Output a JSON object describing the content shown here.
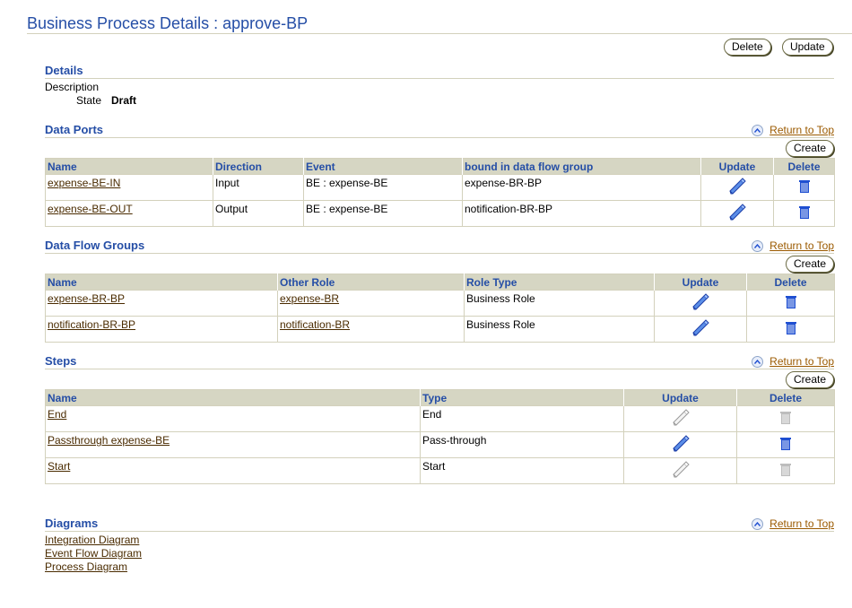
{
  "page": {
    "title": "Business Process Details : approve-BP"
  },
  "header_buttons": {
    "delete": "Delete",
    "update": "Update"
  },
  "details": {
    "heading": "Details",
    "description_label": "Description",
    "description_value": "",
    "state_label": "State",
    "state_value": "Draft"
  },
  "return_to_top": "Return to Top",
  "create_label": "Create",
  "data_ports": {
    "heading": "Data Ports",
    "columns": [
      "Name",
      "Direction",
      "Event",
      "bound in data flow group",
      "Update",
      "Delete"
    ],
    "rows": [
      {
        "name": "expense-BE-IN",
        "direction": "Input",
        "event": "BE : expense-BE",
        "group": "expense-BR-BP",
        "update_enabled": true,
        "delete_enabled": true
      },
      {
        "name": "expense-BE-OUT",
        "direction": "Output",
        "event": "BE : expense-BE",
        "group": "notification-BR-BP",
        "update_enabled": true,
        "delete_enabled": true
      }
    ]
  },
  "data_flow_groups": {
    "heading": "Data Flow Groups",
    "columns": [
      "Name",
      "Other Role",
      "Role Type",
      "Update",
      "Delete"
    ],
    "rows": [
      {
        "name": "expense-BR-BP",
        "other_role": "expense-BR",
        "role_type": "Business Role",
        "update_enabled": true,
        "delete_enabled": true
      },
      {
        "name": "notification-BR-BP",
        "other_role": "notification-BR",
        "role_type": "Business Role",
        "update_enabled": true,
        "delete_enabled": true
      }
    ]
  },
  "steps": {
    "heading": "Steps",
    "columns": [
      "Name",
      "Type",
      "Update",
      "Delete"
    ],
    "rows": [
      {
        "name": "End",
        "type": "End",
        "update_enabled": false,
        "delete_enabled": false
      },
      {
        "name": "Passthrough expense-BE",
        "type": "Pass-through",
        "update_enabled": true,
        "delete_enabled": true
      },
      {
        "name": "Start",
        "type": "Start",
        "update_enabled": false,
        "delete_enabled": false
      }
    ]
  },
  "diagrams": {
    "heading": "Diagrams",
    "links": [
      "Integration Diagram",
      "Event Flow Diagram",
      "Process Diagram"
    ]
  },
  "colors": {
    "accent": "#254ea6",
    "link": "#4a2b00",
    "header_bg": "#d6d6c3",
    "icon_blue": "#1f4fd1",
    "icon_disabled": "#bdbdbd"
  }
}
